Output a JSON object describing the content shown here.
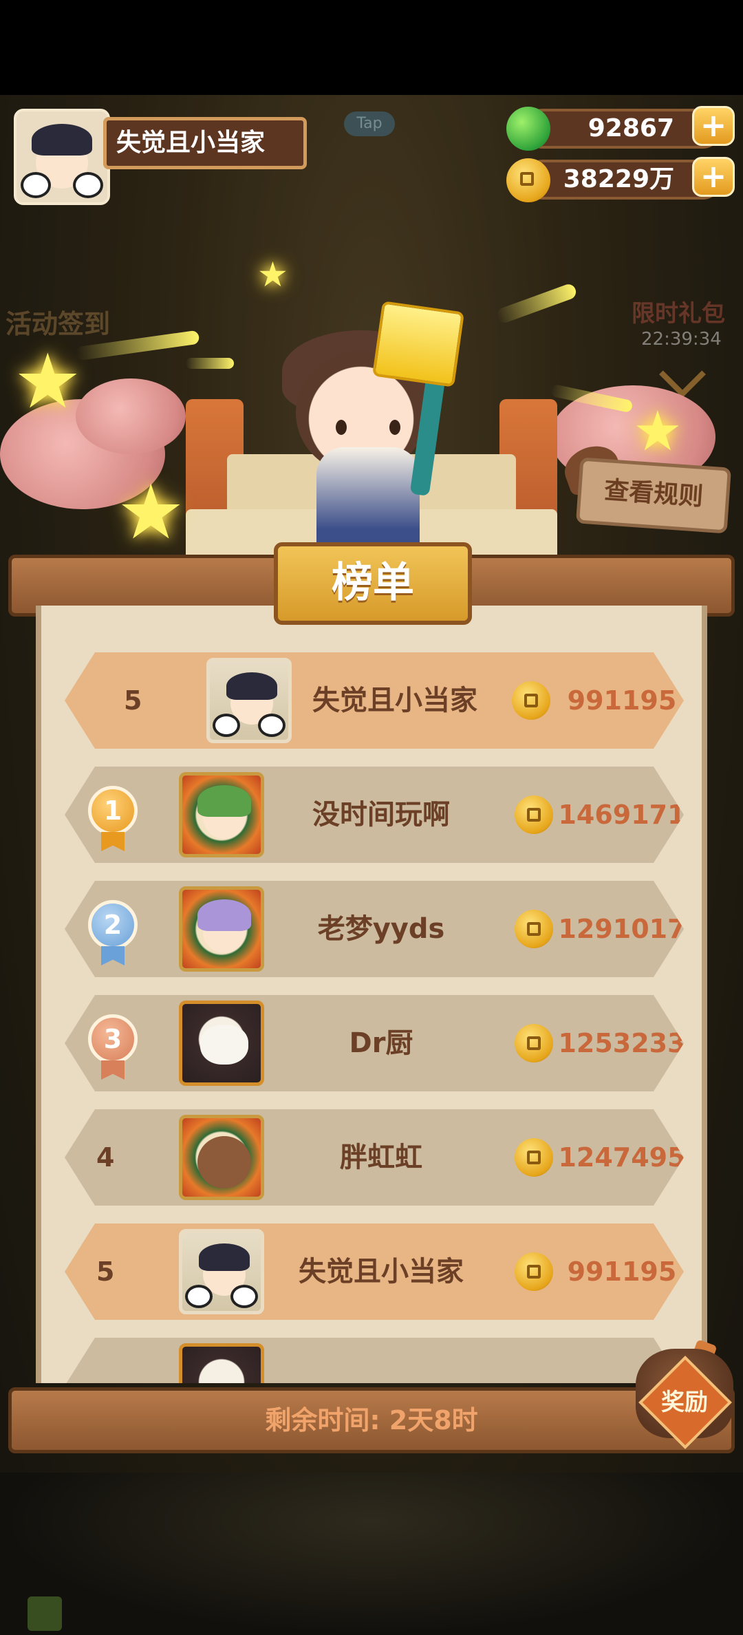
{
  "player": {
    "name": "失觉且小当家"
  },
  "hud": {
    "tap_label": "Tap",
    "apples": "92867",
    "coins": "38229万",
    "plus": "+"
  },
  "side": {
    "left_label": "活动签到",
    "right_label": "限时礼包",
    "right_timer": "22:39:34"
  },
  "rules_button": "查看规则",
  "board": {
    "title": "榜单",
    "self_row": {
      "rank": "5",
      "name": "失觉且小当家",
      "score": "991195"
    },
    "rows": [
      {
        "rank": "1",
        "name": "没时间玩啊",
        "score": "1469171",
        "medal": "gold"
      },
      {
        "rank": "2",
        "name": "老梦yyds",
        "score": "1291017",
        "medal": "silver"
      },
      {
        "rank": "3",
        "name": "Dr厨",
        "score": "1253233",
        "medal": "bronze"
      },
      {
        "rank": "4",
        "name": "胖虹虹",
        "score": "1247495",
        "medal": ""
      },
      {
        "rank": "5",
        "name": "失觉且小当家",
        "score": "991195",
        "medal": ""
      }
    ]
  },
  "footer": {
    "remaining": "剩余时间: 2天8时",
    "reward": "奖励"
  },
  "colors": {
    "score": "#c9683a",
    "name": "#6b4026",
    "self_row": "#e8b685",
    "other_row": "#cdbba0"
  }
}
